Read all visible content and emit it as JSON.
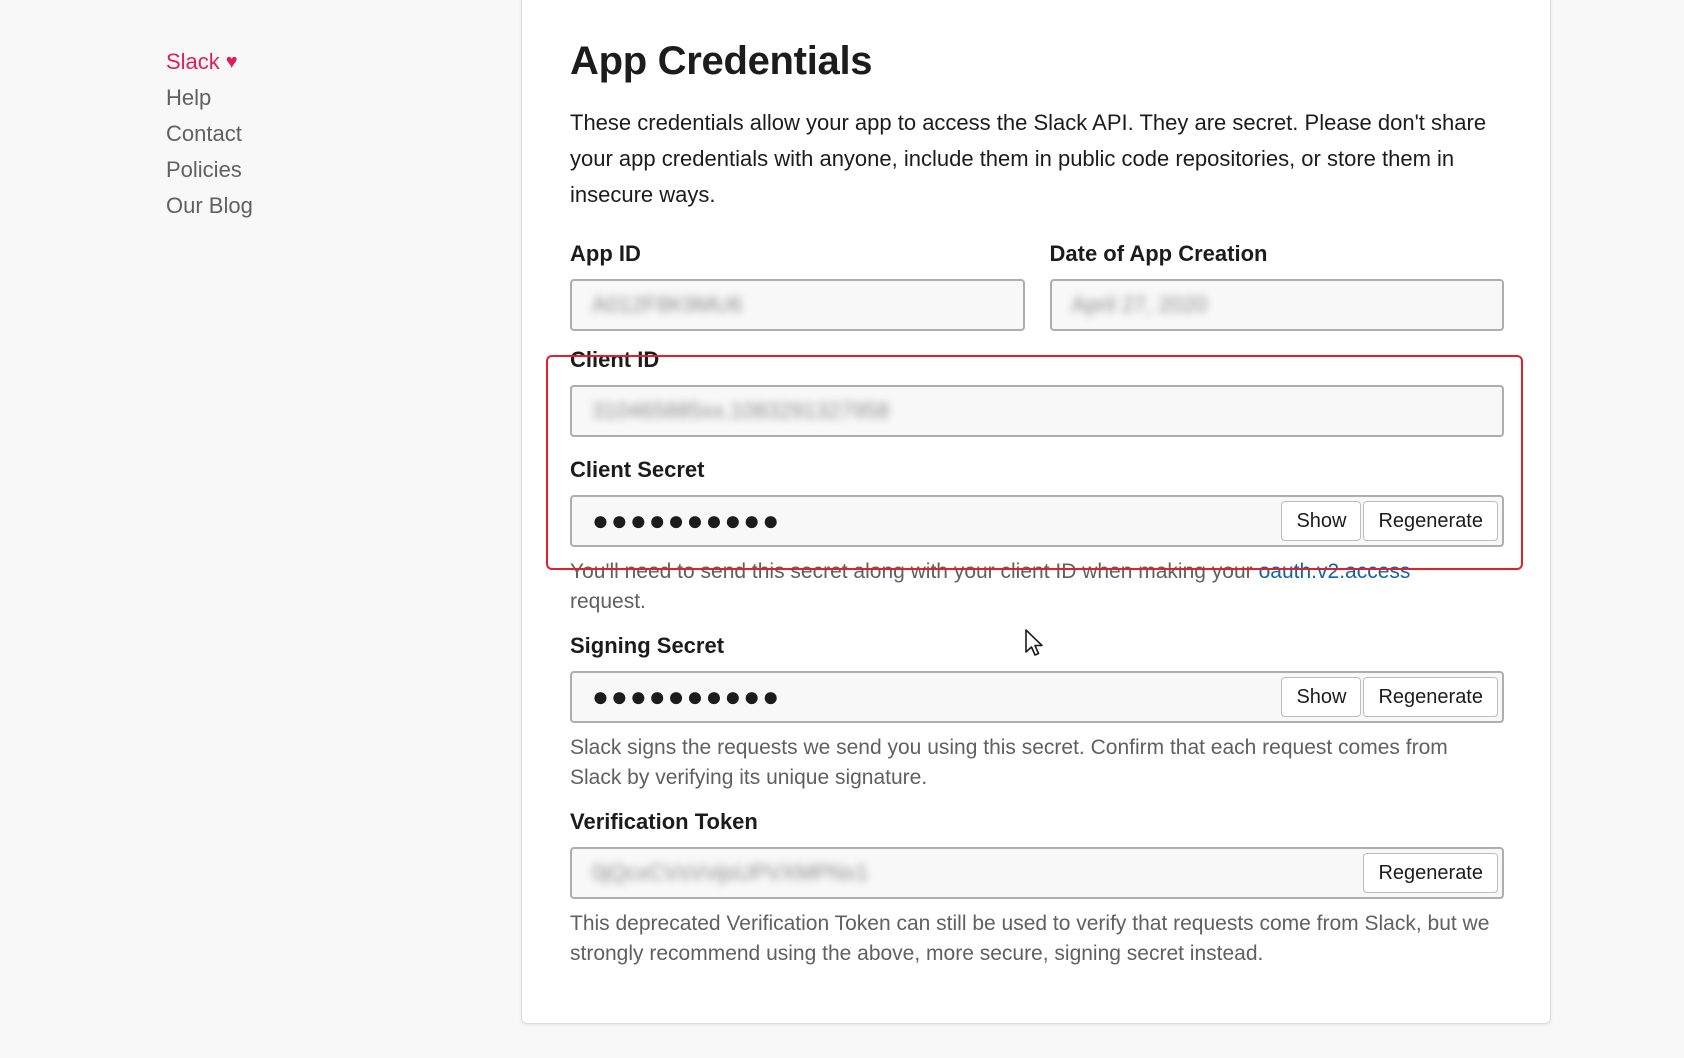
{
  "nav": {
    "items": [
      {
        "label": "Slack",
        "brand": true
      },
      {
        "label": "Help"
      },
      {
        "label": "Contact"
      },
      {
        "label": "Policies"
      },
      {
        "label": "Our Blog"
      }
    ],
    "heart_icon": "♥"
  },
  "main": {
    "title": "App Credentials",
    "intro": "These credentials allow your app to access the Slack API. They are secret. Please don't share your app credentials with anyone, include them in public code repositories, or store them in insecure ways.",
    "app_id": {
      "label": "App ID",
      "value": "A012F8K9MU6"
    },
    "date_created": {
      "label": "Date of App Creation",
      "value": "April 27, 2020"
    },
    "client_id": {
      "label": "Client ID",
      "value": "310465885xx.1083291327958"
    },
    "client_secret": {
      "label": "Client Secret",
      "masked": "●●●●●●●●●●",
      "show_label": "Show",
      "regenerate_label": "Regenerate",
      "help_before": "You'll need to send this secret along with your client ID when making your",
      "help_link": "oauth.v2.access",
      "help_after": "request."
    },
    "signing_secret": {
      "label": "Signing Secret",
      "masked": "●●●●●●●●●●",
      "show_label": "Show",
      "regenerate_label": "Regenerate",
      "help": "Slack signs the requests we send you using this secret. Confirm that each request comes from Slack by verifying its unique signature."
    },
    "verification_token": {
      "label": "Verification Token",
      "value": "0jQcxCVsVvijsUPVXMPNx1",
      "regenerate_label": "Regenerate",
      "help": "This deprecated Verification Token can still be used to verify that requests come from Slack, but we strongly recommend using the above, more secure, signing secret instead."
    }
  },
  "colors": {
    "brand": "#e01e5a",
    "link": "#1264a3",
    "highlight": "#e0202a"
  }
}
